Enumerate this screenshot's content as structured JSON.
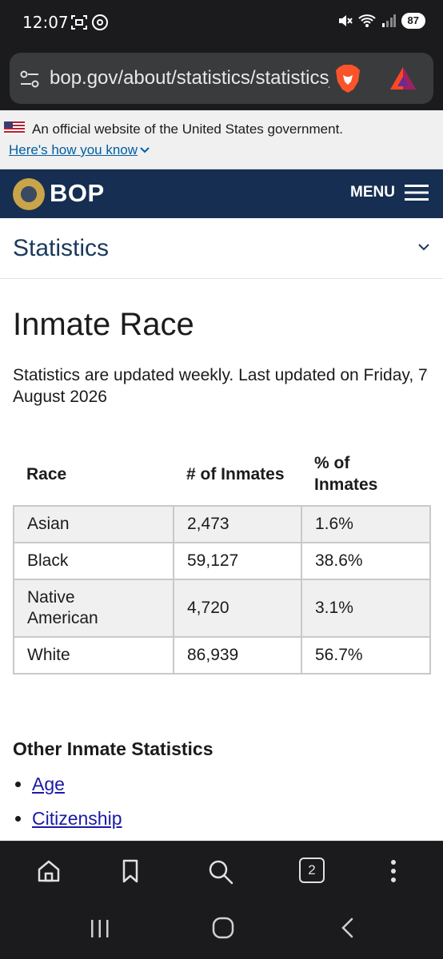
{
  "status_bar": {
    "time": "12:07",
    "battery": "87"
  },
  "browser": {
    "url": "bop.gov/about/statistics/statistics_inmate_race.jsp",
    "tab_count": "2"
  },
  "gov_banner": {
    "text": "An official website of the United States government.",
    "link": "Here's how you know"
  },
  "site_header": {
    "logo_text": "BOP",
    "menu_label": "MENU"
  },
  "section_nav": {
    "title": "Statistics"
  },
  "content": {
    "heading": "Inmate Race",
    "updated": "Statistics are updated weekly. Last updated on Friday, 7 August 2026",
    "table": {
      "headers": [
        "Race",
        "# of Inmates",
        "% of Inmates"
      ],
      "rows": [
        [
          "Asian",
          "2,473",
          "1.6%"
        ],
        [
          "Black",
          "59,127",
          "38.6%"
        ],
        [
          "Native American",
          "4,720",
          "3.1%"
        ],
        [
          "White",
          "86,939",
          "56.7%"
        ]
      ]
    },
    "other_heading": "Other Inmate Statistics",
    "other_links": [
      "Age",
      "Citizenship"
    ]
  },
  "colors": {
    "header_navy": "#162e51",
    "link_blue": "#005ea2",
    "banner_gray": "#f0f0f0"
  }
}
